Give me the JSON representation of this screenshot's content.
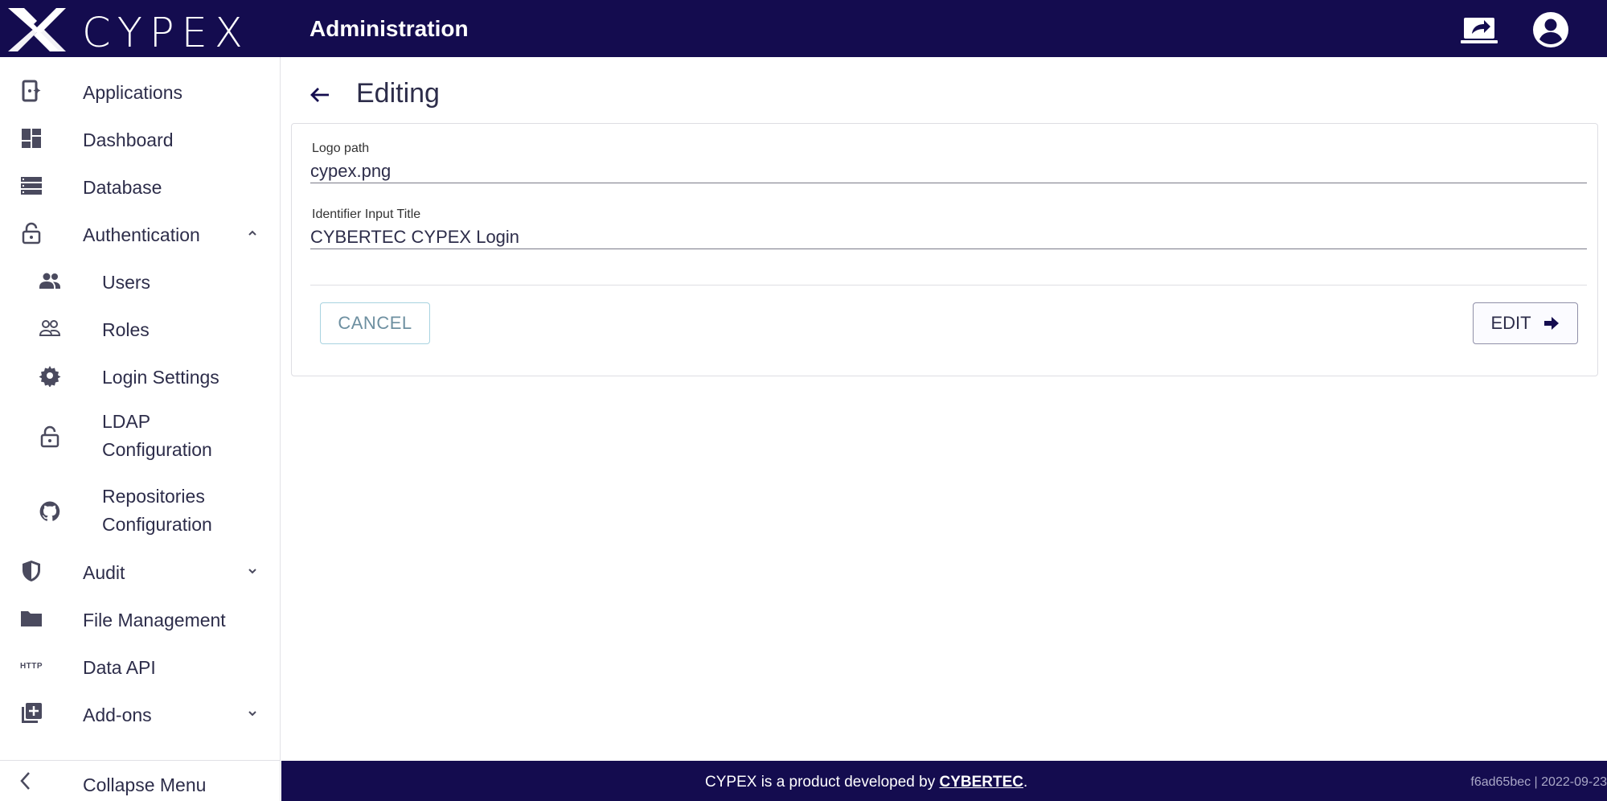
{
  "topbar": {
    "brand": "CYPEX",
    "heading": "Administration",
    "colors": {
      "bar": "#140c4f",
      "text": "#ffffff"
    },
    "icons": [
      "share-screen-icon",
      "account-circle-icon"
    ]
  },
  "sidebar": {
    "items": [
      {
        "label": "Applications",
        "icon": "applications-icon"
      },
      {
        "label": "Dashboard",
        "icon": "dashboard-icon"
      },
      {
        "label": "Database",
        "icon": "database-icon"
      },
      {
        "label": "Authentication",
        "icon": "lock-icon",
        "expanded": true
      },
      {
        "label": "Users",
        "icon": "users-icon"
      },
      {
        "label": "Roles",
        "icon": "roles-icon"
      },
      {
        "label": "Login Settings",
        "icon": "gear-icon"
      },
      {
        "label_line1": "LDAP",
        "label_line2": "Configuration",
        "icon": "lock-icon"
      },
      {
        "label_line1": "Repositories",
        "label_line2": "Configuration",
        "icon": "github-icon"
      },
      {
        "label": "Audit",
        "icon": "shield-icon",
        "expanded": false
      },
      {
        "label": "File Management",
        "icon": "folder-icon"
      },
      {
        "label": "Data API",
        "icon": "http-icon",
        "icon_text": "HTTP"
      },
      {
        "label": "Add-ons",
        "icon": "add-box-icon",
        "expanded": false
      }
    ],
    "collapse_label": "Collapse Menu"
  },
  "main": {
    "title": "Editing",
    "fields": [
      {
        "label": "Logo path",
        "value": "cypex.png"
      },
      {
        "label": "Identifier Input Title",
        "value": "CYBERTEC CYPEX Login"
      }
    ],
    "cancel_label": "CANCEL",
    "edit_label": "EDIT"
  },
  "footer": {
    "credit_prefix": "CYPEX is a product developed by ",
    "credit_link": "CYBERTEC",
    "credit_suffix": ".",
    "version": "f6ad65bec | 2022-09-23"
  }
}
